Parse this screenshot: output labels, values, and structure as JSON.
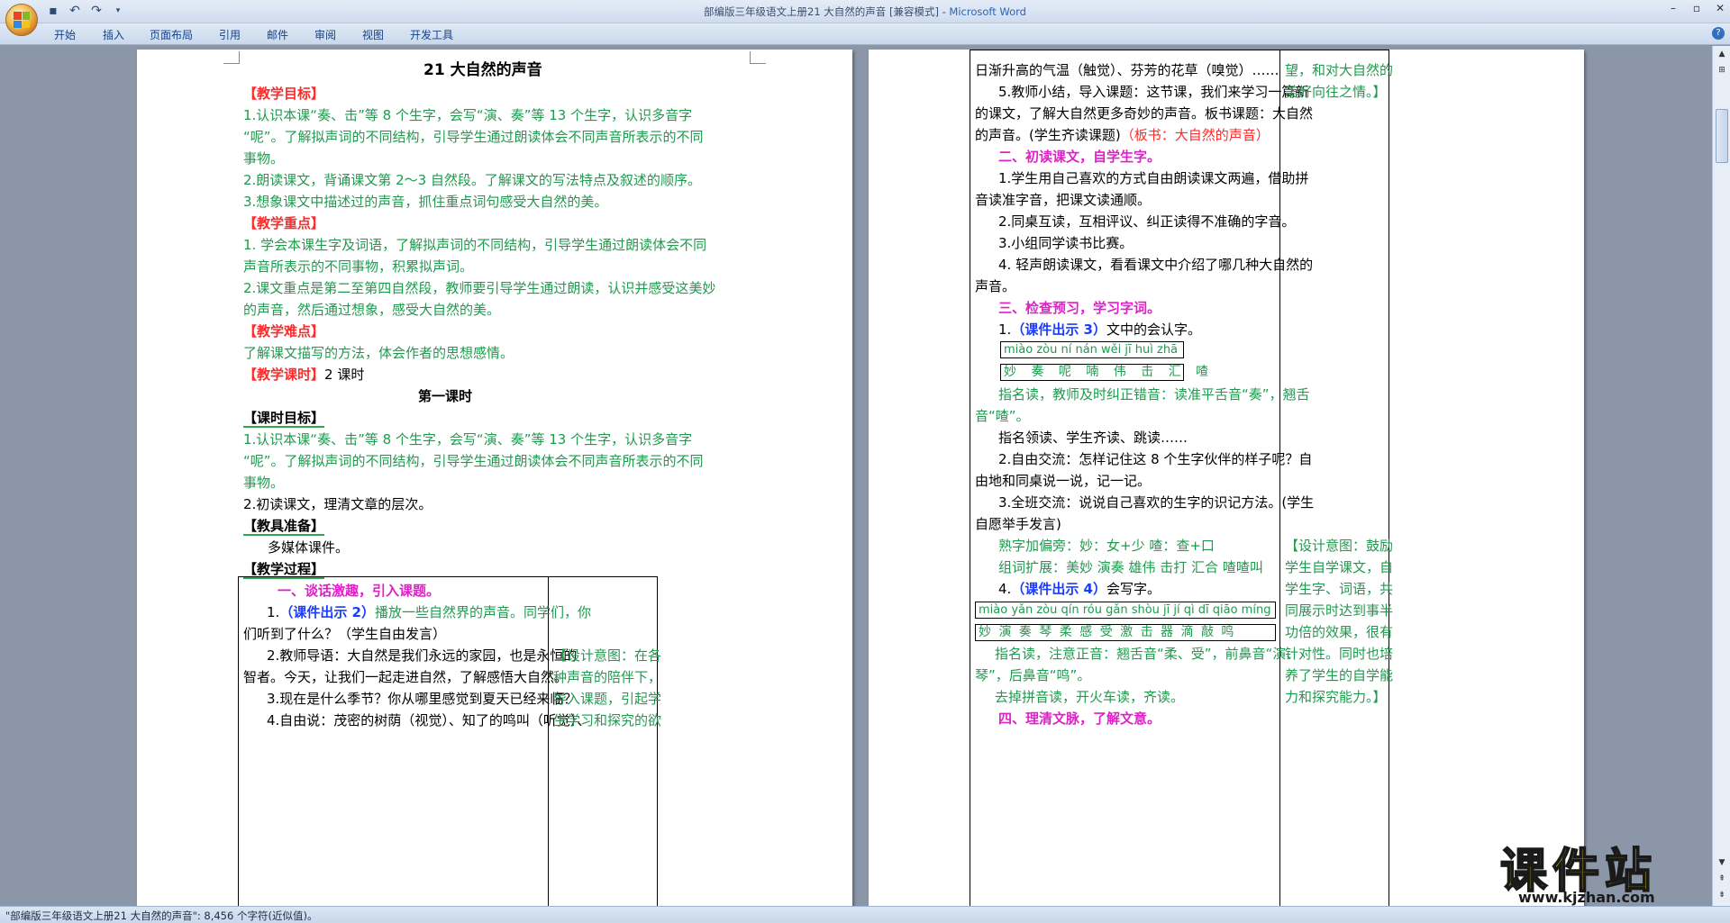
{
  "window": {
    "title_doc": "部编版三年级语文上册21 大自然的声音 [兼容模式] - ",
    "title_app": "Microsoft Word"
  },
  "ribbon_tabs": [
    "开始",
    "插入",
    "页面布局",
    "引用",
    "邮件",
    "审阅",
    "视图",
    "开发工具"
  ],
  "status_bar": "\"部编版三年级语文上册21 大自然的声音\": 8,456 个字符(近似值)。",
  "watermark": {
    "brand": "课件站",
    "url": "www.kjzhan.com"
  },
  "left_page": {
    "title": "21  大自然的声音",
    "lines": [
      "【教学目标】",
      "1.认识本课“奏、击”等 8 个生字，会写“演、奏”等 13 个生字，认识多音字",
      "“呢”。了解拟声词的不同结构，引导学生通过朗读体会不同声音所表示的不同",
      "事物。",
      "2.朗读课文，背诵课文第 2～3 自然段。了解课文的写法特点及叙述的顺序。",
      "3.想象课文中描述过的声音，抓住重点词句感受大自然的美。",
      "【教学重点】",
      "1. 学会本课生字及词语，了解拟声词的不同结构，引导学生通过朗读体会不同",
      "声音所表示的不同事物，积累拟声词。",
      "2.课文重点是第二至第四自然段，教师要引导学生通过朗读，认识并感受这美妙",
      "的声音，然后通过想象，感受大自然的美。",
      "【教学难点】",
      "了解课文描写的方法，体会作者的思想感情。",
      "【教学课时】",
      "2 课时",
      "第一课时",
      "【课时目标】",
      "1.认识本课“奏、击”等 8 个生字，会写“演、奏”等 13 个生字，认识多音字",
      "“呢”。了解拟声词的不同结构，引导学生通过朗读体会不同声音所表示的不同",
      "事物。",
      "2.初读课文，理清文章的层次。",
      "【教具准备】",
      "多媒体课件。",
      "【教学过程】"
    ],
    "table": {
      "left": [
        "一、谈话激趣，引入课题。",
        "1.",
        "（课件出示 2）",
        "播放一些自然界的声音。同学们，你",
        "们听到了什么？（学生自由发言）",
        "2.教师导语：大自然是我们永远的家园，也是永恒的",
        "智者。今天，让我们一起走进自然，了解感悟大自然。",
        "3.现在是什么季节？你从哪里感觉到夏天已经来临？",
        "4.自由说：茂密的树荫（视觉）、知了的鸣叫（听觉）、"
      ],
      "right": [
        "【设计意图：在各",
        "种声音的陪伴下，",
        "导入课题，引起学",
        "生学习和探究的欲"
      ]
    }
  },
  "right_page": {
    "left": [
      "日渐升高的气温（触觉）、芬芳的花草（嗅觉）……",
      "5.教师小结，导入课题：这节课，我们来学习一篇新",
      "的课文，了解大自然更多奇妙的声音。板书课题：大自然",
      "的声音。(学生齐读课题)",
      "（板书：大自然的声音）",
      "二、初读课文，自学生字。",
      "1.学生用自己喜欢的方式自由朗读课文两遍，借助拼",
      "音读准字音，把课文读通顺。",
      "2.同桌互读，互相评议、纠正读得不准确的字音。",
      "3.小组同学读书比赛。",
      "4. 轻声朗读课文，看看课文中介绍了哪几种大自然的",
      "声音。",
      "三、检查预习，学习字词。",
      "1.",
      "（课件出示 3）",
      "文中的会认字。",
      "miào zòu ní nán wěi jī huì zhā",
      "妙 奏 呢 喃 伟 击 汇 喳",
      "指名读，教师及时纠正错音：读准平舌音“奏”，翘舌",
      "音“喳”。",
      "指名领读、学生齐读、跳读……",
      "2.自由交流：怎样记住这 8 个生字伙伴的样子呢？自",
      "由地和同桌说一说，记一记。",
      "3.全班交流：说说自己喜欢的生字的识记方法。(学生",
      "自愿举手发言)",
      "熟字加偏旁：妙：女+少   喳：查+口",
      "组词扩展：美妙  演奏  雄伟  击打  汇合  喳喳叫",
      "4.",
      "（课件出示 4）",
      "会写字。",
      "miào yǎn zòu qín róu gǎn shòu jī jí qì dī qiāo míng",
      "妙  演  奏  琴  柔  感  受   激 击 器 滴  敲  鸣",
      "指名读，注意正音：翘舌音“柔、受”，前鼻音“演、",
      "琴”，后鼻音“鸣”。",
      "去掉拼音读，开火车读，齐读。",
      "四、理清文脉，了解文意。"
    ],
    "right": [
      "望，和对大自然的",
      "美好向往之情。】",
      "【设计意图：鼓励",
      "学生自学课文，自",
      "学生字、词语，共",
      "同展示时达到事半",
      "功倍的效果，很有",
      "针对性。同时也培",
      "养了学生的自学能",
      "力和探究能力。】"
    ]
  }
}
